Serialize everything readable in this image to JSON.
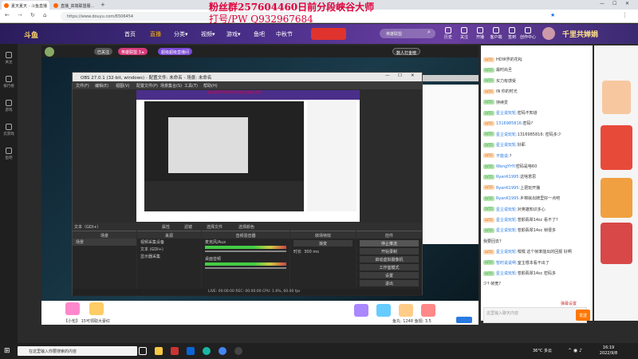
{
  "browser": {
    "tabs": [
      {
        "label": "夏天夏天 - 斗鱼直播"
      },
      {
        "label": "直播_高端联盟服..."
      }
    ],
    "url": "https://www.douyu.com/6506454"
  },
  "overlay": {
    "line1": "粉丝群257604460日前分段峡谷大师",
    "line2": "打号/PW Q932967684"
  },
  "header": {
    "nav": [
      "首页",
      "直播",
      "分类▾",
      "视频▾",
      "游戏▾",
      "鱼吧",
      "中秋节"
    ],
    "search_placeholder": "英雄联盟",
    "icons": [
      {
        "label": "历史",
        "icon": "history-icon"
      },
      {
        "label": "关注",
        "icon": "follow-icon"
      },
      {
        "label": "开播",
        "icon": "broadcast-icon"
      },
      {
        "label": "客户端",
        "icon": "client-icon"
      },
      {
        "label": "签到",
        "icon": "checkin-icon"
      },
      {
        "label": "创作中心",
        "icon": "creator-icon"
      }
    ],
    "promo": "千里共婵娟"
  },
  "sidebar": [
    {
      "label": "关注",
      "icon": "heart-icon"
    },
    {
      "label": "排行榜",
      "icon": "rank-icon"
    },
    {
      "label": "游戏",
      "icon": "game-icon"
    },
    {
      "label": "云游戏",
      "icon": "cloud-game-icon"
    },
    {
      "label": "鱼吧",
      "icon": "fish-icon"
    }
  ],
  "stream_info": {
    "level_badge": "已关注",
    "tag1": "英雄联盟 3 ▸",
    "tag2": "超级超级直播间",
    "pill_right": "数人打金榜"
  },
  "obs": {
    "title": "OBS 27.0.1 (32-bit, windows) - 配置文件: 未命名 - 场景: 未命名",
    "menu": [
      "文件(F)",
      "编辑(E)",
      "视图(V)",
      "配置文件(P)",
      "场景集合(S)",
      "工具(T)",
      "帮助(H)"
    ],
    "preview_caption": "粉丝群257604460日前分段峡谷大师",
    "toolbar": [
      "属性",
      "滤镜",
      "选择文件",
      "选择颜色"
    ],
    "source_label": "文本（GDI+）",
    "docks": {
      "scenes": {
        "title": "场景",
        "items": [
          "场景"
        ]
      },
      "sources": {
        "title": "来源",
        "items": [
          "视频采集设备",
          "文本 (GDI+)",
          "显示器采集"
        ]
      },
      "mixer": {
        "title": "音频混音器",
        "tracks": [
          "麦克风/Aux",
          "桌面音频"
        ]
      },
      "transitions": {
        "title": "转场特效",
        "type": "渐变",
        "duration_label": "时长",
        "duration": "300 ms"
      },
      "controls": {
        "title": "控件",
        "buttons": [
          "停止推流",
          "开始录制",
          "启动虚拟摄像机",
          "工作室模式",
          "设置",
          "退出"
        ]
      }
    },
    "status": "LIVE: 00:00:00   REC: 00:00:00   CPU: 1.6%, 60.00 fps"
  },
  "chat": {
    "messages": [
      {
        "level": "LV15",
        "user": "",
        "text": "HD世界的花RJ"
      },
      {
        "level": "LV15",
        "user": "",
        "text": "最时尚旦"
      },
      {
        "level": "LV15",
        "user": "",
        "text": "买力有感受"
      },
      {
        "level": "LV15",
        "user": "",
        "text": "IN 你的时光"
      },
      {
        "level": "LV15",
        "user": "",
        "text": "持续爱"
      },
      {
        "level": "LV15",
        "user": "星尘说玩轮:",
        "text": "密码不知道"
      },
      {
        "level": "LV15",
        "user": "1316985816:",
        "text": "密码?"
      },
      {
        "level": "LV15",
        "user": "星尘说玩轮:",
        "text": "1316985816: 密码多少"
      },
      {
        "level": "LV15",
        "user": "星尘说玩轮:",
        "text": "好耶"
      },
      {
        "level": "LV15",
        "user": "不能说:",
        "text": "?"
      },
      {
        "level": "LV15",
        "user": "WangYHY:",
        "text": "密码是啥60"
      },
      {
        "level": "LV15",
        "user": "RyanK1995:",
        "text": "这啥意思"
      },
      {
        "level": "LV15",
        "user": "RyanK1995:",
        "text": "上把玩开播"
      },
      {
        "level": "LV15",
        "user": "RyanK1995:",
        "text": "乡棉就出牌里好一点吧"
      },
      {
        "level": "LV15",
        "user": "星尘说玩轮:",
        "text": "对英雄知识多心"
      },
      {
        "level": "LV15",
        "user": "星尘说玩轮:",
        "text": "苍颜翡翠14sc  看不了?"
      },
      {
        "level": "LV15",
        "user": "星尘说玩轮:",
        "text": "苍颜翡翠14sc  帧很多"
      },
      {
        "level": "",
        "user": "",
        "text": "我要回去?"
      },
      {
        "level": "LV15",
        "user": "星尘说玩轮:",
        "text": "嘿嘿 这个帧率能出的回报 好啊"
      },
      {
        "level": "LV15",
        "user": "暂时说说咧:",
        "text": "室主根本看不出了"
      },
      {
        "level": "LV15",
        "user": "星尘说玩轮:",
        "text": "苍颜翡翠14sc  密码多"
      },
      {
        "level": "",
        "user": "",
        "text": "少? 帧宽?"
      }
    ],
    "input_placeholder": "这里输入聊天内容",
    "send_label": "发送",
    "bottom_link": "弹幕设置"
  },
  "gift_bar": {
    "label": "【小包】 15可领取大豪红",
    "stats": "鱼丸: 1248  鱼翅: 3.5"
  },
  "taskbar": {
    "search_placeholder": "在这里输入你要搜索的内容",
    "weather": "36°C 多云",
    "time": "16:19",
    "date": "2022/9/8"
  }
}
